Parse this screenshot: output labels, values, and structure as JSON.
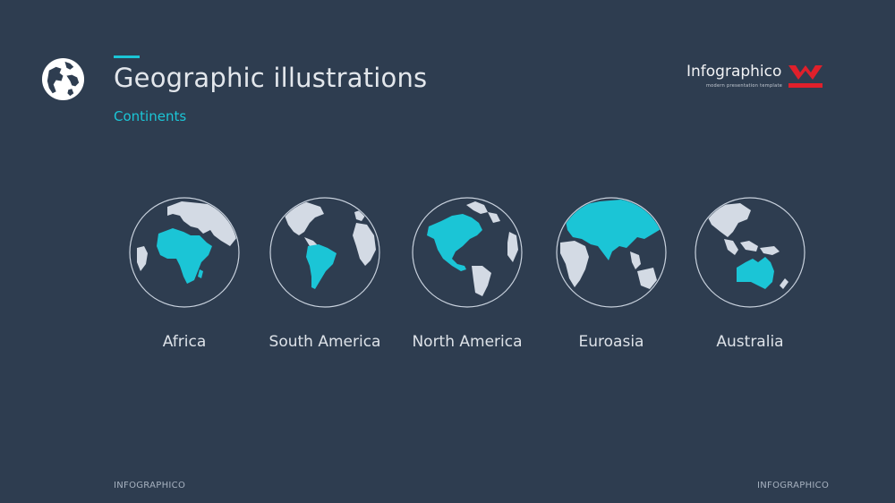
{
  "header": {
    "icon": "globe-icon",
    "title": "Geographic illustrations",
    "subtitle": "Continents",
    "accent_color": "#1bc5d6"
  },
  "brand": {
    "name": "Infographico",
    "tagline": "modern presentation template",
    "logo_icon": "infographico-logo-icon",
    "logo_color": "#e0202b"
  },
  "continents": [
    {
      "label": "Africa",
      "icon": "africa-globe-icon"
    },
    {
      "label": "South America",
      "icon": "south-america-globe-icon"
    },
    {
      "label": "North America",
      "icon": "north-america-globe-icon"
    },
    {
      "label": "Euroasia",
      "icon": "euroasia-globe-icon"
    },
    {
      "label": "Australia",
      "icon": "australia-globe-icon"
    }
  ],
  "colors": {
    "background": "#2e3d50",
    "highlight": "#1bc5d6",
    "land": "#d3dae4",
    "globe_outline": "#c9d2de"
  },
  "footer": {
    "left_text": "INFOGRAPHICO",
    "right_text": "INFOGRAPHICO"
  }
}
